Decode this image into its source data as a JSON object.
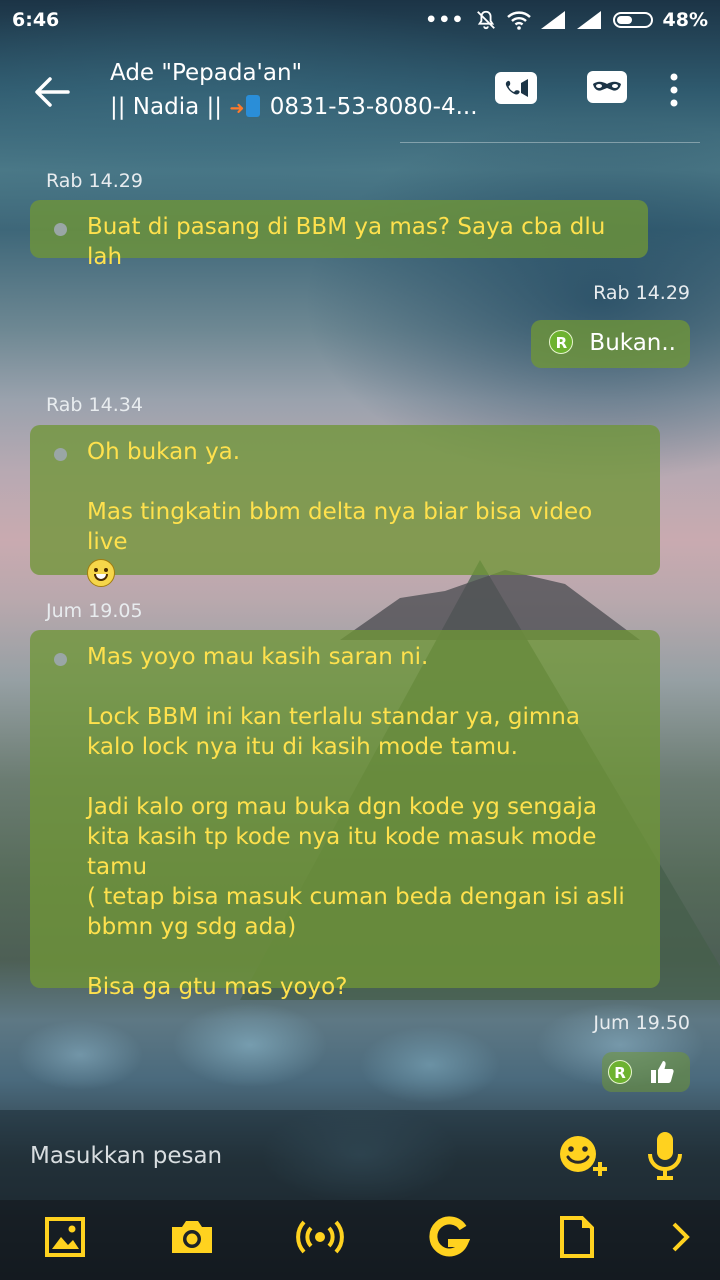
{
  "status_bar": {
    "time": "6:46",
    "battery": "48%",
    "battery_level": 0.48
  },
  "header": {
    "line1": "Ade \"Pepada'an\"",
    "line2_prefix": "|| Nadia ||",
    "line2_number": "0831-53-8080-4..."
  },
  "messages": [
    {
      "time": "Rab 14.29",
      "text": "Buat di pasang di BBM ya mas? Saya cba dlu lah"
    },
    {
      "time": "Rab 14.29",
      "text": "Bukan..",
      "status": "R"
    },
    {
      "time": "Rab 14.34",
      "text": "Oh bukan ya.\n\nMas tingkatin bbm delta nya biar bisa video live"
    },
    {
      "time": "Jum 19.05",
      "text": "Mas yoyo mau kasih saran ni.\n\nLock BBM ini kan terlalu standar ya, gimna  kalo lock nya itu di kasih mode tamu.\n\nJadi kalo org mau buka dgn kode yg sengaja kita kasih tp kode nya itu kode masuk mode tamu\n( tetap bisa masuk cuman beda dengan isi asli bbmn yg sdg ada)\n\nBisa ga gtu mas yoyo?"
    },
    {
      "time": "Jum 19.50",
      "status": "R"
    }
  ],
  "compose": {
    "placeholder": "Masukkan pesan"
  },
  "colors": {
    "bubble": "#709637",
    "incoming_text": "#ffe14d",
    "icon_yellow": "#ffd21f",
    "read_badge": "#6db230"
  },
  "icons": {
    "header": [
      "back-arrow-icon",
      "video-call-icon",
      "mask-icon",
      "more-vert-icon"
    ],
    "compose": [
      "emoji-add-icon",
      "microphone-icon"
    ],
    "toolbar": [
      "image-icon",
      "camera-icon",
      "broadcast-icon",
      "glympse-icon",
      "file-icon",
      "chevron-right-icon"
    ]
  }
}
